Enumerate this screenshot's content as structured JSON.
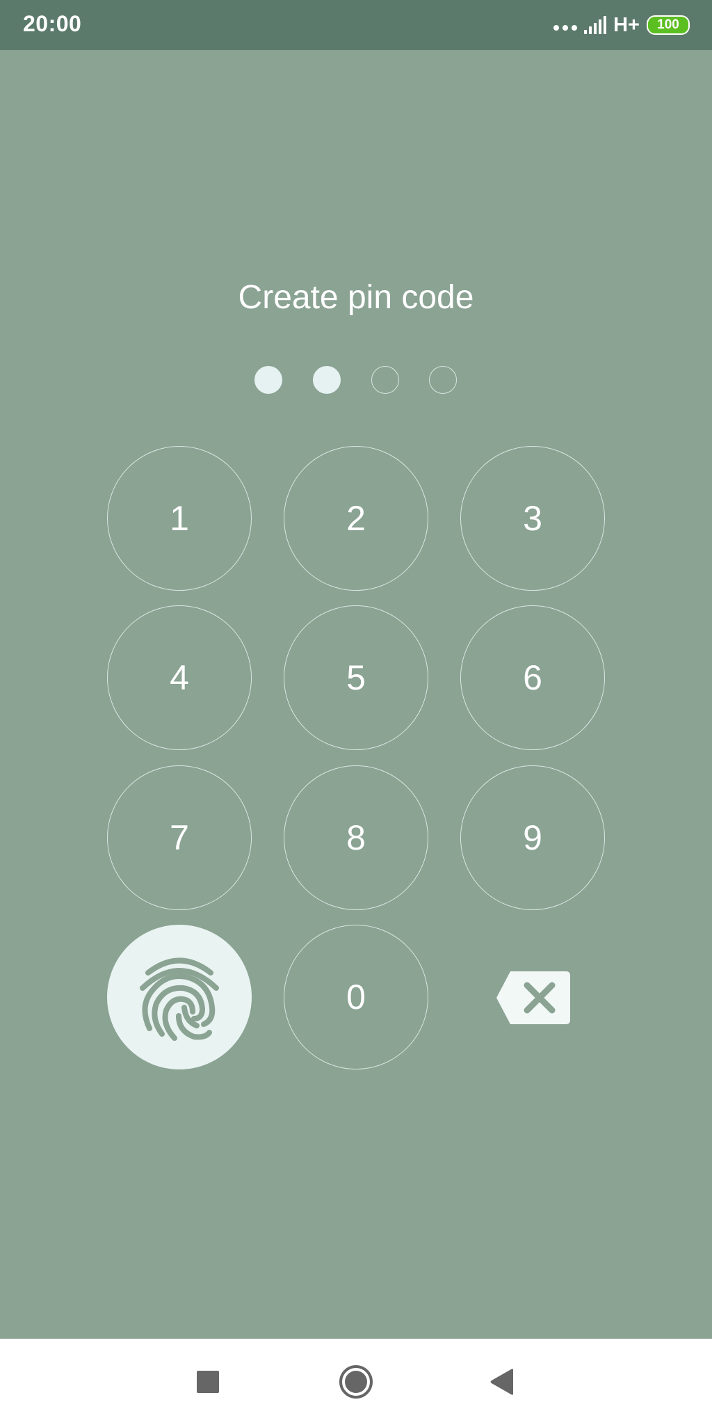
{
  "status_bar": {
    "time": "20:00",
    "network": "H+",
    "battery": "100",
    "battery_color": "#5bbf21"
  },
  "pin": {
    "title": "Create pin code",
    "length": 4,
    "entered": 2
  },
  "keypad": {
    "keys": [
      "1",
      "2",
      "3",
      "4",
      "5",
      "6",
      "7",
      "8",
      "9",
      "0"
    ],
    "fingerprint_icon": "fingerprint-icon",
    "backspace_icon": "backspace-icon"
  },
  "nav_bar": {
    "recents_icon": "square-icon",
    "home_icon": "circle-icon",
    "back_icon": "triangle-back-icon"
  },
  "colors": {
    "background": "#8aa393",
    "status_bar": "#5c7a6b",
    "accent_light": "#e9f3f1"
  }
}
